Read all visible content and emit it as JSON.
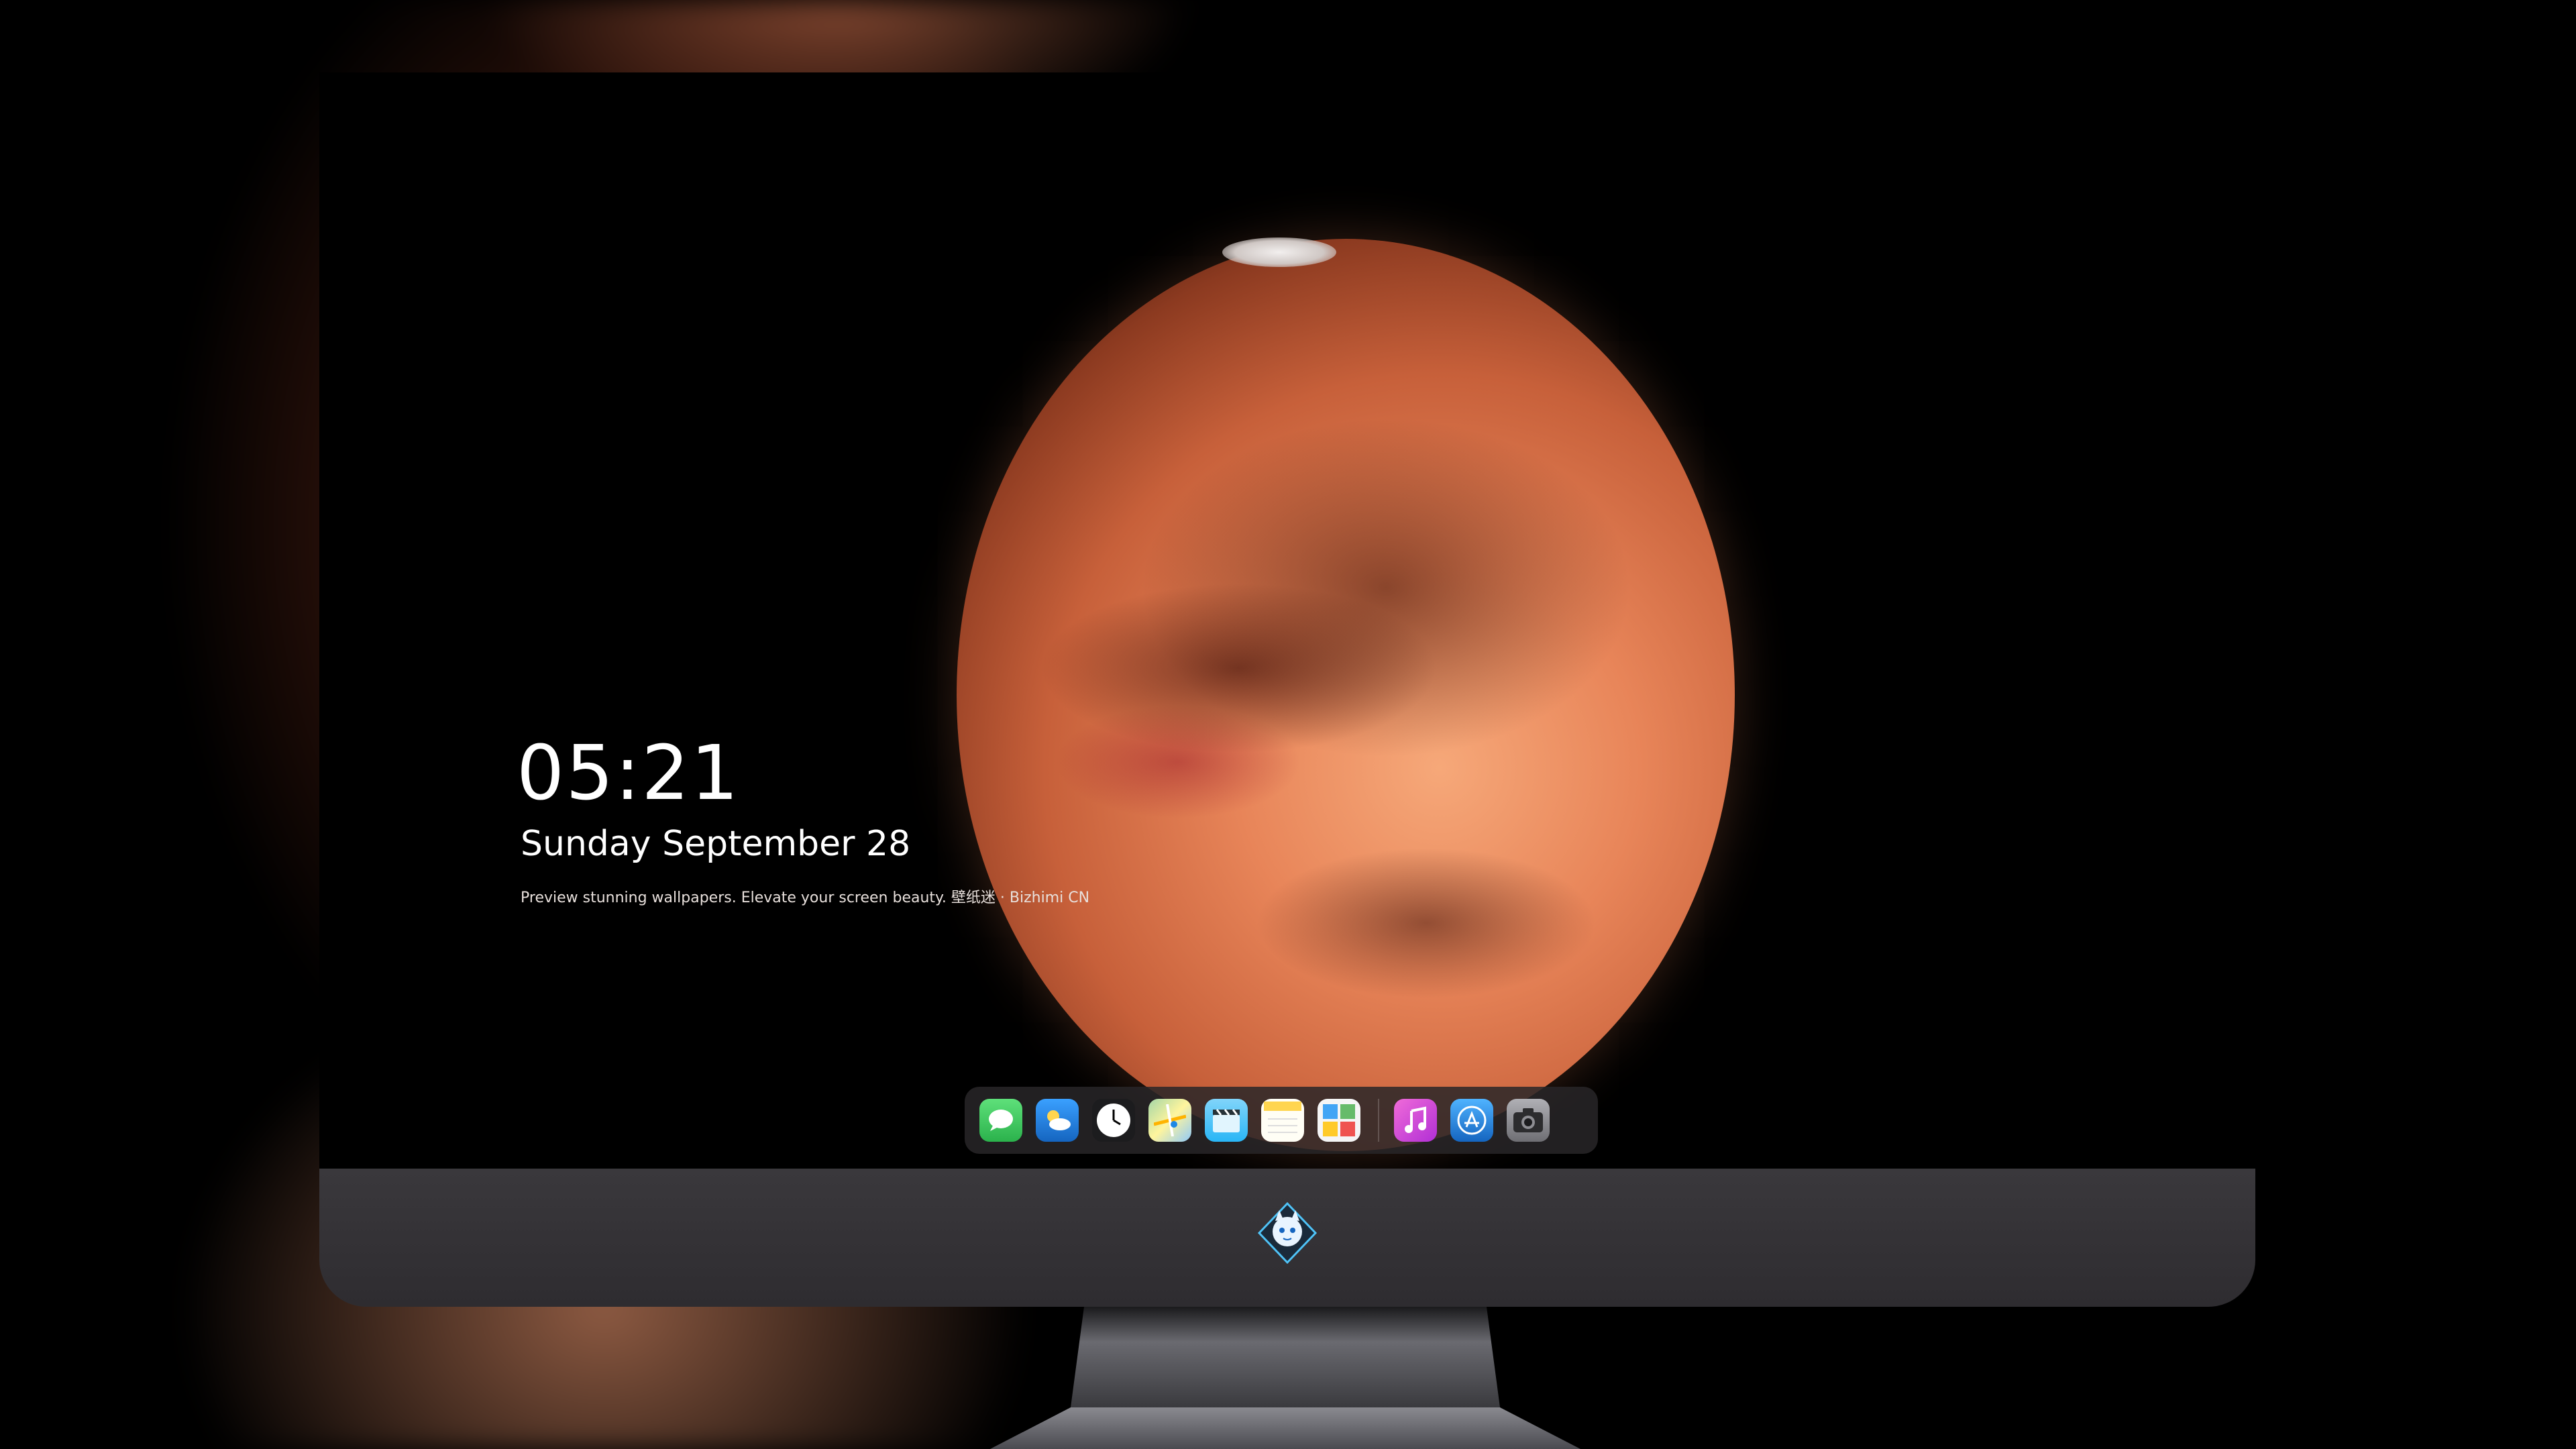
{
  "lock_screen": {
    "time": "05:21",
    "date": "Sunday September  28",
    "caption": "Preview stunning wallpapers. Elevate your screen beauty. 壁纸迷 · Bizhimi CN"
  },
  "dock": {
    "apps": [
      {
        "name": "messages-icon",
        "color": "#34c759"
      },
      {
        "name": "weather-icon",
        "color": "#1e88e5"
      },
      {
        "name": "clock-icon",
        "color": "#ffffff"
      },
      {
        "name": "maps-icon",
        "color": "#f5c542"
      },
      {
        "name": "clips-icon",
        "color": "#4fc3f7"
      },
      {
        "name": "notes-icon",
        "color": "#ffd54f"
      },
      {
        "name": "photos-icon",
        "color": "#ffffff"
      },
      {
        "name": "music-icon",
        "color": "#d946ef"
      },
      {
        "name": "app-store-icon",
        "color": "#1e90ff"
      },
      {
        "name": "camera-icon",
        "color": "#8e8e93"
      }
    ]
  },
  "colors": {
    "planet": "#e88559",
    "chin": "#3a383c",
    "dock": "#282628"
  }
}
